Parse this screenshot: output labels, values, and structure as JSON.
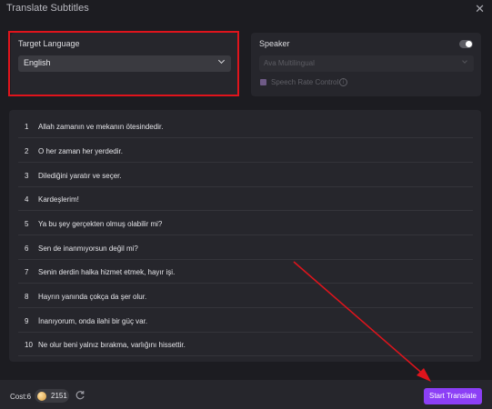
{
  "window": {
    "title": "Translate Subtitles",
    "close_icon": "close-icon"
  },
  "target_language": {
    "label": "Target Language",
    "selected": "English"
  },
  "speaker": {
    "label": "Speaker",
    "toggle_on": false,
    "voice": "Ava Multilingual",
    "speech_rate_label": "Speech Rate Control",
    "speech_rate_checked": true
  },
  "subtitles": [
    {
      "num": "1",
      "text": "Allah zamanın ve mekanın ötesindedir."
    },
    {
      "num": "2",
      "text": "O her zaman her yerdedir."
    },
    {
      "num": "3",
      "text": "Dilediğini yaratır ve seçer."
    },
    {
      "num": "4",
      "text": "Kardeşlerim!"
    },
    {
      "num": "5",
      "text": "Ya bu şey gerçekten olmuş olabilir mi?"
    },
    {
      "num": "6",
      "text": "Sen de inanmıyorsun değil mi?"
    },
    {
      "num": "7",
      "text": "Senin derdin halka hizmet etmek, hayır işi."
    },
    {
      "num": "8",
      "text": "Hayrın yanında çokça da şer olur."
    },
    {
      "num": "9",
      "text": "İnanıyorum, onda ilahi bir güç var."
    },
    {
      "num": "10",
      "text": "Ne olur beni yalnız bırakma, varlığını hissettir."
    }
  ],
  "footer": {
    "cost_label": "Cost:6",
    "coin_count": "2151",
    "start_button": "Start Translate"
  },
  "colors": {
    "accent": "#8c3ff6",
    "highlight": "#e0141c",
    "background": "#1c1c21",
    "panel": "#26262c"
  }
}
